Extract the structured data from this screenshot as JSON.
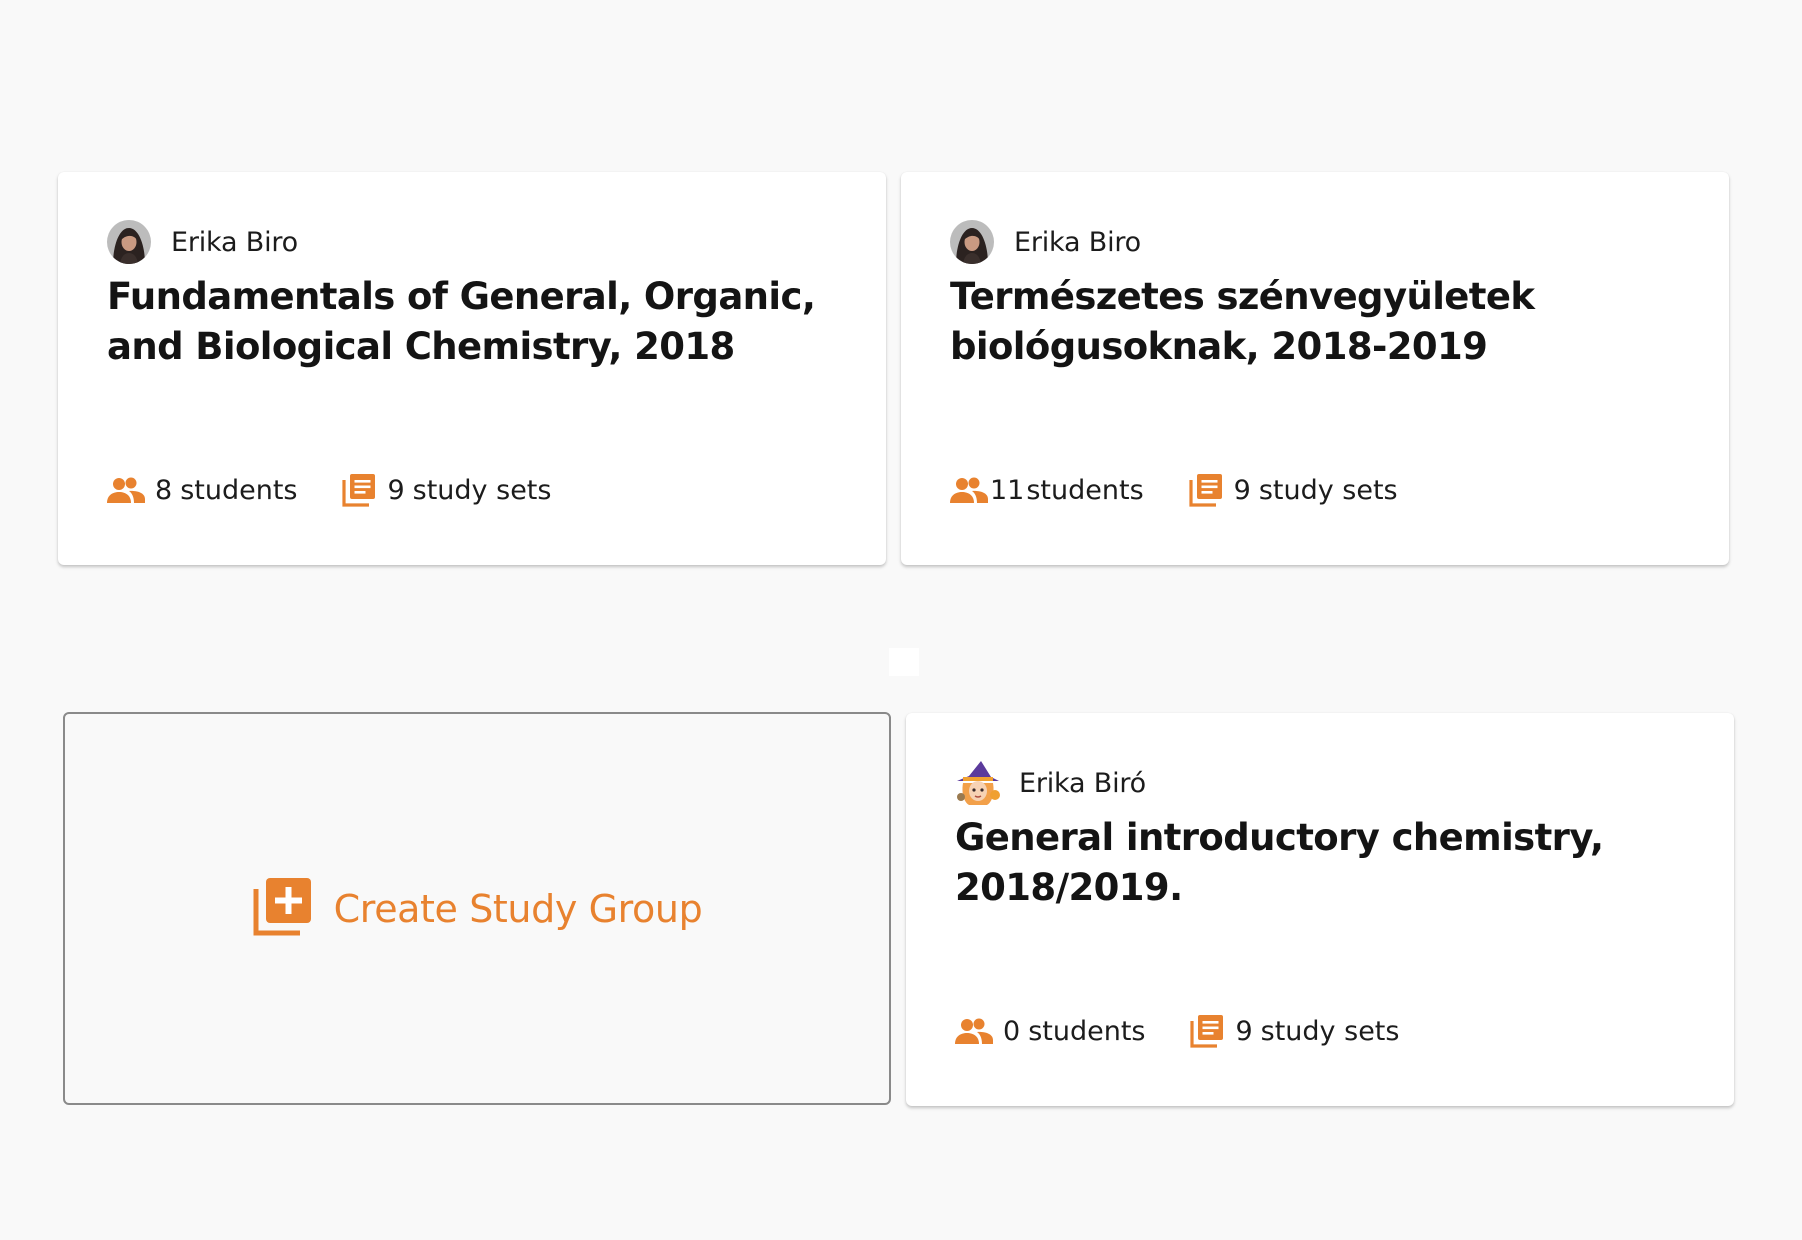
{
  "colors": {
    "accent": "#e8822f",
    "card_bg": "#ffffff",
    "page_bg": "#f9f9f9",
    "text": "#141414"
  },
  "groups": [
    {
      "author": "Erika Biro",
      "avatar_icon": "author-photo-avatar",
      "title": "Fundamentals of General, Organic, and Biological Chemistry, 2018",
      "students_count": "8",
      "students_label": "students",
      "sets_count": "9",
      "sets_label": "study sets"
    },
    {
      "author": "Erika Biro",
      "avatar_icon": "author-photo-avatar",
      "title": "Természetes szénvegyületek biológusoknak, 2018-2019",
      "students_count": "11",
      "students_label": "students",
      "sets_count": "9",
      "sets_label": "study sets"
    },
    {
      "author": "Erika Biró",
      "avatar_icon": "witch-cartoon-avatar",
      "title": "General introductory chemistry, 2018/2019.",
      "students_count": "0",
      "students_label": "students",
      "sets_count": "9",
      "sets_label": "study sets"
    }
  ],
  "create": {
    "label": "Create Study Group",
    "icon": "add-library-icon"
  }
}
